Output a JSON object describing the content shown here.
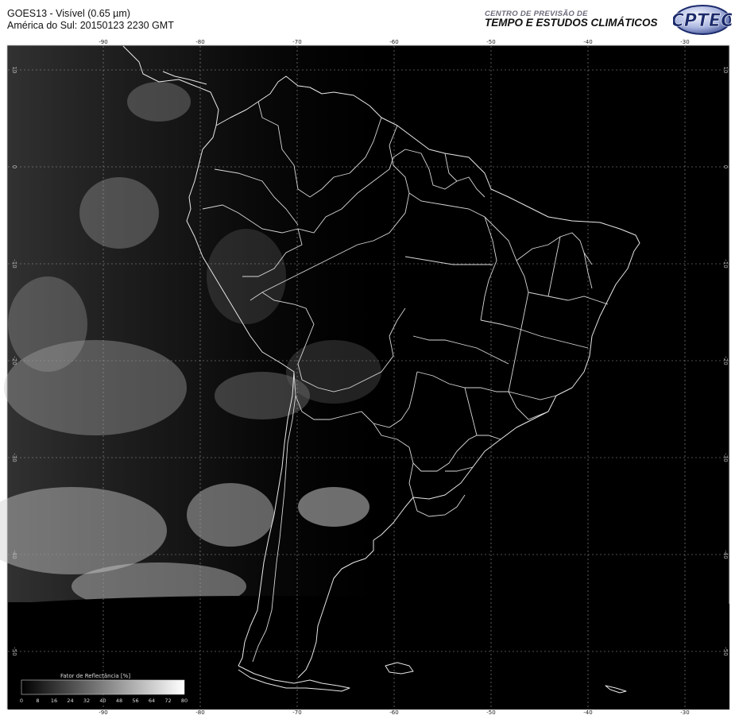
{
  "header": {
    "line1": "GOES13 - Visível (0.65 µm)",
    "line2": "América do Sul: 20150123 2230 GMT",
    "center_small": "CENTRO DE PREVISÃO DE",
    "center_big": "TEMPO E ESTUDOS CLIMÁTICOS",
    "logo_text": "CPTEC"
  },
  "map": {
    "lon_labels": [
      "-90",
      "-80",
      "-70",
      "-60",
      "-50",
      "-40",
      "-30"
    ],
    "lat_labels": [
      "10",
      "0",
      "-10",
      "-20",
      "-30",
      "-40",
      "-50"
    ],
    "colors": {
      "background": "#000000",
      "coast": "#e8e8e8",
      "grid": "#9a9a9a"
    }
  },
  "legend": {
    "title": "Fator de Reflectância [%]",
    "ticks": [
      "0",
      "8",
      "16",
      "24",
      "32",
      "40",
      "48",
      "56",
      "64",
      "72",
      "80"
    ]
  }
}
